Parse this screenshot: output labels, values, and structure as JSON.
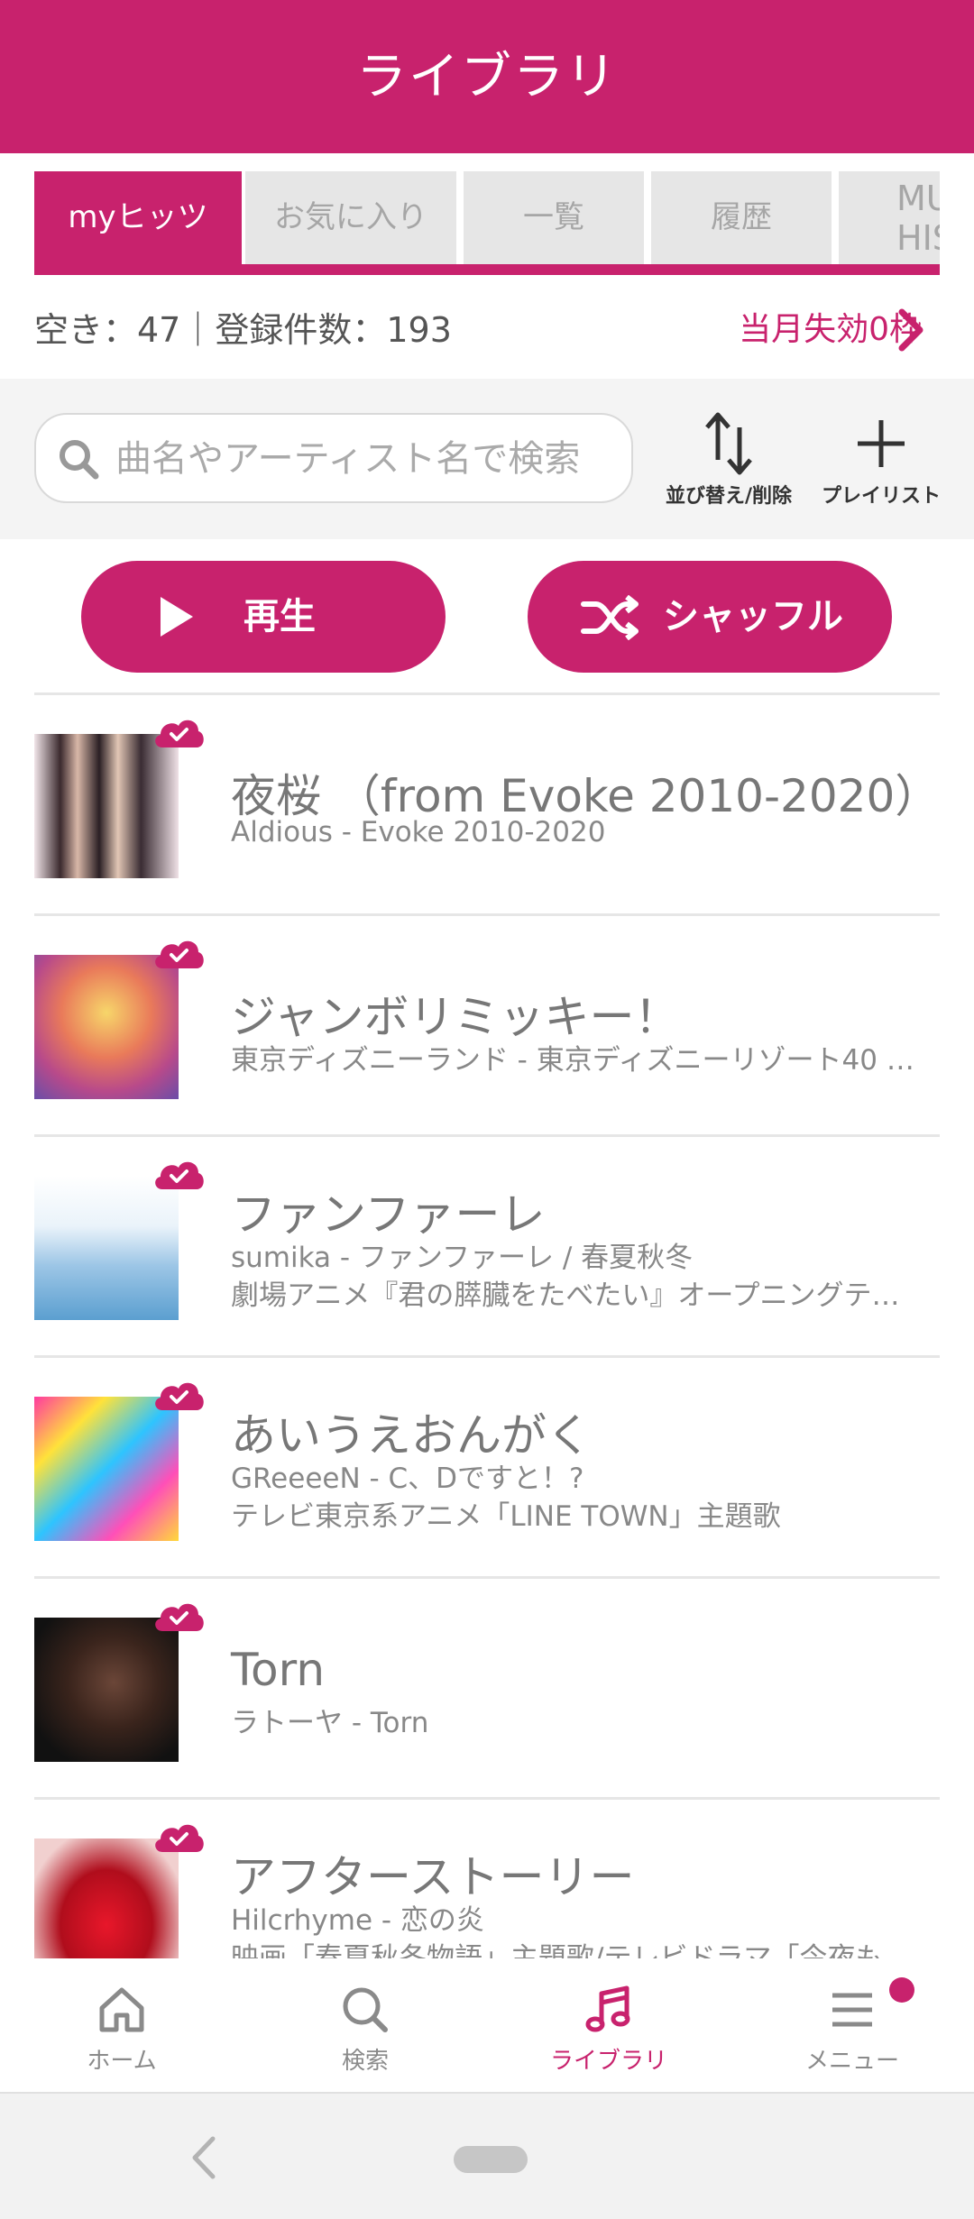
{
  "header": {
    "title": "ライブラリ"
  },
  "tabs": [
    {
      "label": "myヒッツ",
      "active": true
    },
    {
      "label": "お気に入り"
    },
    {
      "label": "一覧"
    },
    {
      "label": "履歴"
    },
    {
      "label_line1": "MU",
      "label_line2": "HIST"
    }
  ],
  "status": {
    "capacity": "空き：47｜登録件数：193",
    "expire_link": "当月失効0枠"
  },
  "search": {
    "placeholder": "曲名やアーティスト名で検索"
  },
  "tools": {
    "sort_label": "並び替え/削除",
    "playlist_label": "プレイリスト"
  },
  "actions": {
    "play_label": "再生",
    "shuffle_label": "シャッフル"
  },
  "tracks": [
    {
      "title": "夜桜 （from Evoke 2010-2020）",
      "line1": "Aldious - Evoke 2010-2020",
      "line2": ""
    },
    {
      "title": "ジャンボリミッキー！",
      "line1": "東京ディズニーランド - 東京ディズニーリゾート40 周…",
      "line2": ""
    },
    {
      "title": "ファンファーレ",
      "line1": "sumika - ファンファーレ / 春夏秋冬",
      "line2": "劇場アニメ『君の膵臓をたべたい』オープニングテーマ"
    },
    {
      "title": "あいうえおんがく",
      "line1": "GReeeeN - C、Dですと！?",
      "line2": "テレビ東京系アニメ「LINE TOWN」主題歌"
    },
    {
      "title": "Torn",
      "line1": "ラトーヤ - Torn",
      "line2": ""
    },
    {
      "title": "アフターストーリー",
      "line1": "Hilcrhyme - 恋の炎",
      "line2": "映画「春夏秋冬物語」主題歌/テレビドラマ「今夜もし」…"
    }
  ],
  "nav": {
    "home": "ホーム",
    "search": "検索",
    "library": "ライブラリ",
    "menu": "メニュー"
  },
  "colors": {
    "accent": "#c8226d",
    "tab_inactive": "#e6e6e6",
    "band": "#f4f4f4"
  }
}
